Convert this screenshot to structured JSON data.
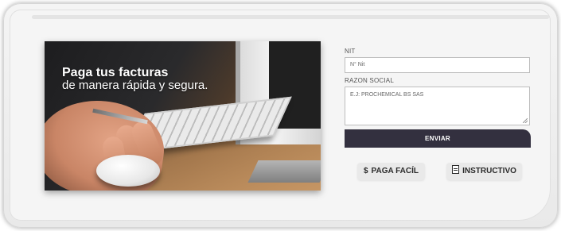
{
  "banner": {
    "headline_line1": "Paga tus facturas",
    "headline_line2": "de manera rápida y segura."
  },
  "form": {
    "nit_label": "NIT",
    "nit_placeholder": "N° Nit",
    "razon_label": "RAZON SOCIAL",
    "razon_placeholder": "E.J: PROCHEMICAL BS SAS",
    "submit_label": "ENVIAR"
  },
  "actions": {
    "paga_facil": {
      "icon": "dollar-icon",
      "glyph": "$",
      "label": "PAGA FACÍL"
    },
    "instructivo": {
      "icon": "document-icon",
      "label": "INSTRUCTIVO"
    }
  },
  "colors": {
    "submit_bg": "#33303f",
    "card_bg": "#f5f5f5",
    "pill_bg": "#e9e9e9"
  }
}
